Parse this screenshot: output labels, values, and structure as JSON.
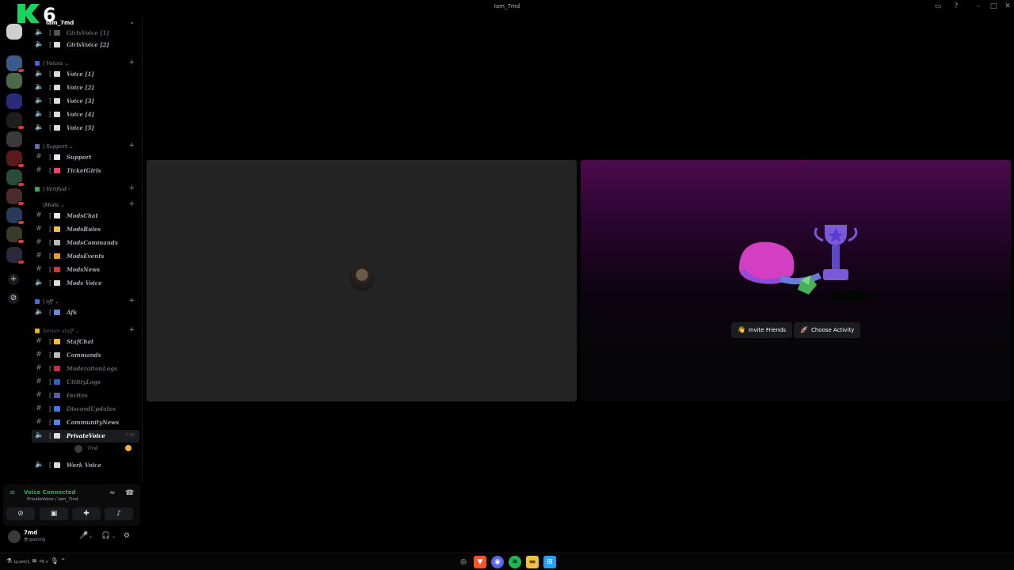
{
  "window": {
    "title": "Iam_7md"
  },
  "overlay": {
    "logo_letter": "K",
    "logo_number": "6"
  },
  "server": {
    "name": "Iam_7md"
  },
  "categories": {
    "voices": "| Voices ⌄",
    "support": "| Support ⌄",
    "verified": "| Verified ›",
    "mods": "|Mods ⌄",
    "off": "| off ⌄",
    "server_staff": "Server staff ⌄"
  },
  "channels": {
    "girls_voice_1": "GirlsVoice [1]",
    "girls_voice_2": "GirlsVoice [2]",
    "voice_1": "Voice [1]",
    "voice_2": "Voice [2]",
    "voice_3": "Voice [3]",
    "voice_4": "Voice [4]",
    "voice_5": "Voice [5]",
    "support": "Support",
    "ticket_girls": "TicketGirls",
    "mods_chat": "ModsChat",
    "mods_rules": "ModsRules",
    "mods_commands": "ModsCommands",
    "mods_events": "ModsEvents",
    "mods_news": "ModsNews",
    "mods_voice": "Mods Voice",
    "afk": "Afk",
    "staf_chat": "StafChat",
    "commands": "Commands",
    "moderation_logs": "ModeraitonLogs",
    "utility_logs": "UtilityLogs",
    "invites": "Invites",
    "discord_updates": "DiscordUpdates",
    "community_news": "CommunityNews",
    "private_voice": "PrivateVoice",
    "private_voice_time": "7:58",
    "work_voice": "Work Voice"
  },
  "voice_member": {
    "name": "7md"
  },
  "voice_panel": {
    "status": "Voice Connected",
    "location": "PrivateVoice / Iam_7md"
  },
  "user_panel": {
    "name": "7md",
    "status": "😎 gooning"
  },
  "activity": {
    "invite_label": "Invite Friends",
    "choose_label": "Choose Activity"
  },
  "taskbar": {
    "left_text": "Ly.yely1",
    "left_small": "ϵ"
  },
  "colors": {
    "voice_green": "#3ba55d",
    "badge_red": "#da373c",
    "activity_purple": "#4b0a4d",
    "logo_green": "#1bd35a"
  }
}
